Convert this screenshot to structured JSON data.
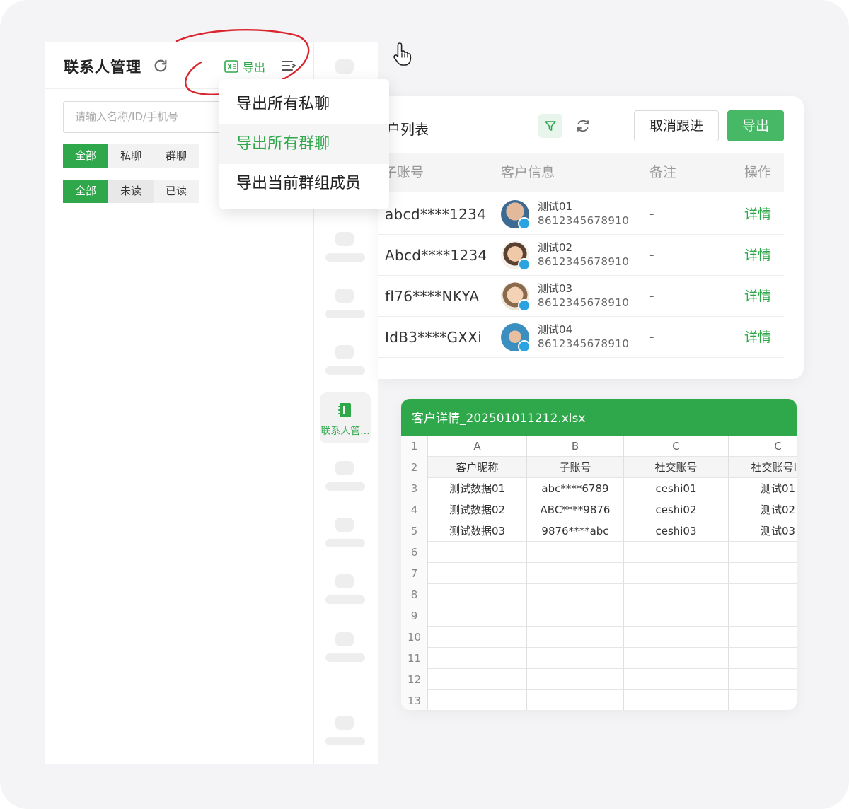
{
  "left_panel": {
    "title": "联系人管理",
    "export_label": "导出",
    "search_placeholder": "请输入名称/ID/手机号",
    "filter_type": [
      "全部",
      "私聊",
      "群聊"
    ],
    "filter_read": [
      "全部",
      "未读",
      "已读"
    ]
  },
  "dropdown": {
    "items": [
      "导出所有私聊",
      "导出所有群聊",
      "导出当前群组成员"
    ],
    "hovered_index": 1
  },
  "nav": {
    "active_label": "联系人管..."
  },
  "customer_list": {
    "title": "户列表",
    "cancel_follow_label": "取消跟进",
    "export_label": "导出",
    "columns": [
      "子账号",
      "客户信息",
      "备注",
      "操作"
    ],
    "rows": [
      {
        "account": "abcd****1234",
        "name": "测试01",
        "phone": "8612345678910",
        "remark": "-",
        "action": "详情"
      },
      {
        "account": "Abcd****1234",
        "name": "测试02",
        "phone": "8612345678910",
        "remark": "-",
        "action": "详情"
      },
      {
        "account": "fl76****NKYA",
        "name": "测试03",
        "phone": "8612345678910",
        "remark": "-",
        "action": "详情"
      },
      {
        "account": "IdB3****GXXi",
        "name": "测试04",
        "phone": "8612345678910",
        "remark": "-",
        "action": "详情"
      }
    ]
  },
  "excel": {
    "filename": "客户详情_202501011212.xlsx",
    "column_letters": [
      "A",
      "B",
      "C",
      "C"
    ],
    "headers": [
      "客户昵称",
      "子账号",
      "社交账号",
      "社交账号ID"
    ],
    "rows": [
      [
        "测试数据01",
        "abc****6789",
        "ceshi01",
        "测试01"
      ],
      [
        "测试数据02",
        "ABC****9876",
        "ceshi02",
        "测试02"
      ],
      [
        "测试数据03",
        "9876****abc",
        "ceshi03",
        "测试03"
      ]
    ],
    "row_numbers": [
      "1",
      "2",
      "3",
      "4",
      "5",
      "6",
      "7",
      "8",
      "9",
      "10",
      "11",
      "12",
      "13"
    ]
  },
  "colors": {
    "accent": "#2ea84a",
    "annotation": "#d9252e"
  }
}
